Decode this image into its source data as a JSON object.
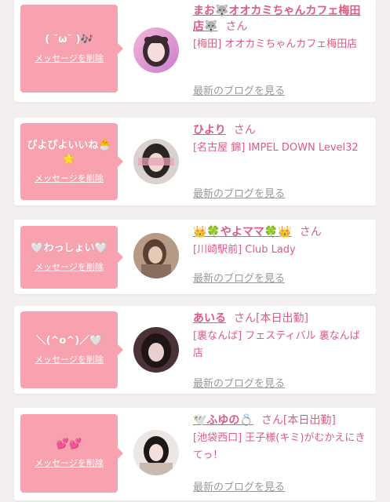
{
  "colors": {
    "accent": "#e05a80",
    "bubble": "#f7a2ae",
    "muted": "#999999",
    "background": "#f3efef"
  },
  "common": {
    "delete_label": "メッセージを削除",
    "blog_label": "最新のブログを見る",
    "honorific": "さん"
  },
  "cards": [
    {
      "message": "( ˘ω˘ )🎶",
      "name": "まお🐺オオカミちゃんカフェ梅田店🐺",
      "status": "",
      "shop": "[梅田] オオカミちゃんカフェ梅田店",
      "avatar_icon": "girl-photo-icon"
    },
    {
      "message": "ぴよぴよいいね🐣🌟",
      "name": "ひより",
      "status": "",
      "shop": "[名古屋 錦] IMPEL DOWN Level32",
      "avatar_icon": "girl-photo-icon"
    },
    {
      "message": "🤍わっしょい🤍",
      "name": "👑🍀やよママ🍀👑",
      "status": "",
      "shop": "[川崎駅前] Club Lady",
      "avatar_icon": "girl-photo-icon"
    },
    {
      "message": "＼(^o^)／🤍",
      "name": "あいる",
      "status": "[本日出勤]",
      "shop": "[裏なんば] フェスティバル 裏なんば店",
      "avatar_icon": "girl-photo-icon"
    },
    {
      "message": "💕💕",
      "name": "🕊️ふゆの💍",
      "status": "[本日出勤]",
      "shop": "[池袋西口] 王子様(キミ)がむかえにきてっ！",
      "avatar_icon": "girl-photo-icon"
    }
  ]
}
